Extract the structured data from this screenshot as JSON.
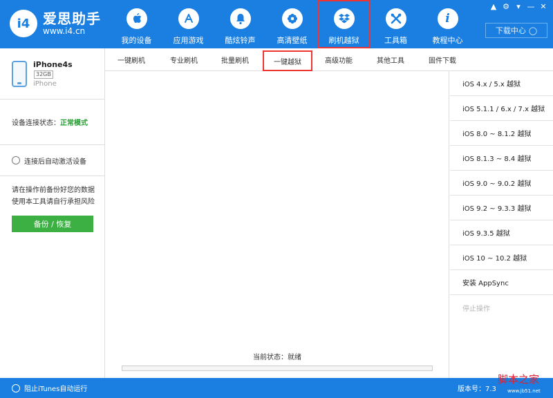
{
  "app": {
    "logo_mark": "i4",
    "title": "爱思助手",
    "url": "www.i4.cn"
  },
  "nav": [
    {
      "label": "我的设备",
      "icon": "apple-icon"
    },
    {
      "label": "应用游戏",
      "icon": "appstore-icon"
    },
    {
      "label": "酷炫铃声",
      "icon": "bell-icon"
    },
    {
      "label": "高清壁纸",
      "icon": "flower-icon"
    },
    {
      "label": "刷机越狱",
      "icon": "dropbox-icon"
    },
    {
      "label": "工具箱",
      "icon": "tools-icon"
    },
    {
      "label": "教程中心",
      "icon": "info-icon"
    }
  ],
  "window_controls": [
    "shirt-icon",
    "gear-icon",
    "menu-icon",
    "minimize-icon",
    "close-icon"
  ],
  "download_center": "下载中心",
  "device": {
    "name": "iPhone4s",
    "capacity": "32GB",
    "model": "iPhone"
  },
  "connection": {
    "label": "设备连接状态：",
    "value": "正常模式"
  },
  "auto_activate": "连接后自动激活设备",
  "backup_note_1": "请在操作前备份好您的数据",
  "backup_note_2": "使用本工具请自行承担风险",
  "backup_button": "备份 / 恢复",
  "tabs": [
    "一键刷机",
    "专业刷机",
    "批量刷机",
    "一键越狱",
    "高级功能",
    "其他工具",
    "固件下载"
  ],
  "jailbreak_options": [
    "iOS 4.x / 5.x 越狱",
    "iOS 5.1.1 / 6.x / 7.x 越狱",
    "iOS 8.0 ~ 8.1.2 越狱",
    "iOS 8.1.3 ~ 8.4 越狱",
    "iOS 9.0 ~ 9.0.2 越狱",
    "iOS 9.2 ~ 9.3.3 越狱",
    "iOS 9.3.5 越狱",
    "iOS 10 ~ 10.2 越狱",
    "安装 AppSync"
  ],
  "stop_operation": "停止操作",
  "status": "当前状态：就绪",
  "progress": 0,
  "footer": {
    "itunes_toggle": "阻止iTunes自动运行",
    "version": "版本号：7.3"
  },
  "watermark": "脚本之家",
  "watermark_url": "www.jb51.net",
  "colors": {
    "header": "#1a7fe0",
    "accent_green": "#3cb043",
    "highlight_red": "#e33"
  }
}
